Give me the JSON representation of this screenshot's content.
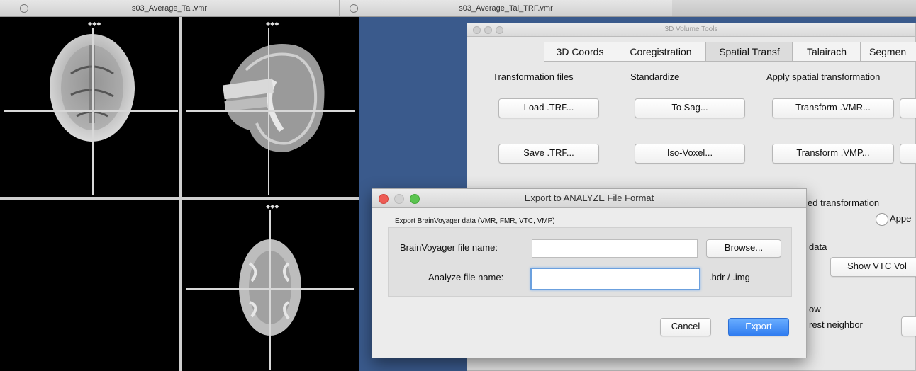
{
  "windows": {
    "left_title": "s03_Average_Tal.vmr",
    "right_title": "s03_Average_Tal_TRF.vmr"
  },
  "volume_tools": {
    "title": "3D Volume Tools",
    "tabs": [
      "3D Coords",
      "Coregistration",
      "Spatial Transf",
      "Talairach",
      "Segmen"
    ],
    "active_tab_index": 2,
    "sections": {
      "transformation_files": "Transformation files",
      "standardize": "Standardize",
      "apply": "Apply spatial transformation"
    },
    "buttons": {
      "load_trf": "Load .TRF...",
      "save_trf": "Save .TRF...",
      "to_sag": "To Sag...",
      "iso_voxel": "Iso-Voxel...",
      "transform_vmr": "Transform .VMR...",
      "transform_vmp": "Transform .VMP...",
      "show_vtc": "Show VTC Vol"
    },
    "partial_labels": {
      "ed_transformation": "ed transformation",
      "appe": "Appe",
      "data": "data",
      "ow": "ow",
      "rest_neighbor": "rest neighbor"
    }
  },
  "export_dialog": {
    "title": "Export to ANALYZE File Format",
    "group_label": "Export BrainVoyager data  (VMR, FMR, VTC, VMP)",
    "bv_label": "BrainVoyager file name:",
    "bv_value": "",
    "analyze_label": "Analyze file name:",
    "analyze_value": "",
    "browse": "Browse...",
    "ext": ".hdr / .img",
    "cancel": "Cancel",
    "export": "Export"
  }
}
